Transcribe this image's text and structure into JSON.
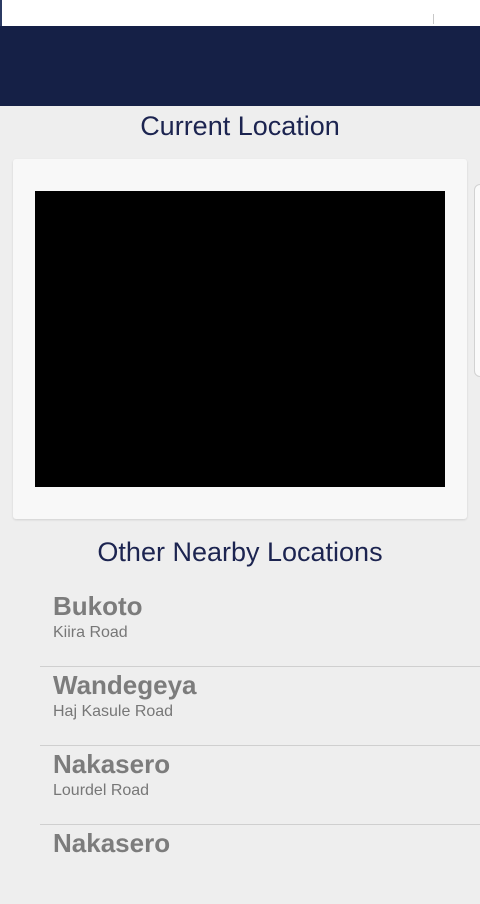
{
  "sections": {
    "current_location_title": "Current Location",
    "nearby_title": "Other Nearby Locations"
  },
  "locations": [
    {
      "name": "Bukoto",
      "street": "Kiira Road"
    },
    {
      "name": "Wandegeya",
      "street": "Haj Kasule Road"
    },
    {
      "name": "Nakasero",
      "street": "Lourdel Road"
    },
    {
      "name": "Nakasero",
      "street": ""
    }
  ],
  "colors": {
    "header": "#152046",
    "title_text": "#1c2450",
    "background": "#eeeeee",
    "map": "#000000",
    "list_text": "#7c7c7c"
  }
}
